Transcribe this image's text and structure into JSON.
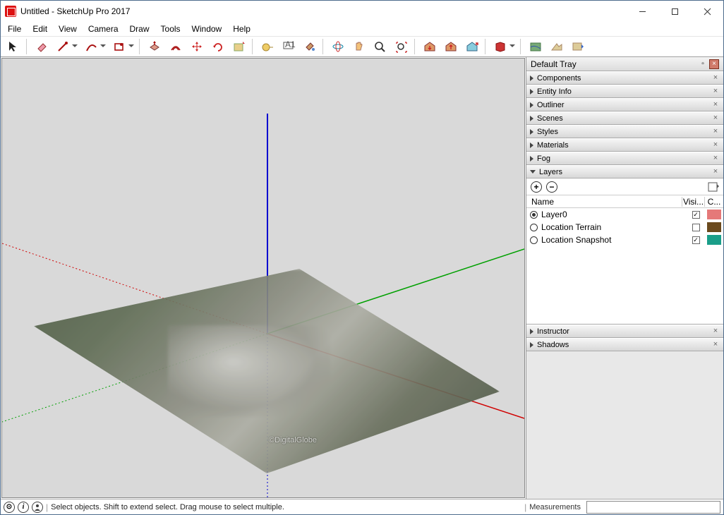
{
  "window": {
    "title": "Untitled - SketchUp Pro 2017"
  },
  "menu": [
    "File",
    "Edit",
    "View",
    "Camera",
    "Draw",
    "Tools",
    "Window",
    "Help"
  ],
  "tray": {
    "title": "Default Tray",
    "panels": [
      {
        "label": "Components",
        "open": false
      },
      {
        "label": "Entity Info",
        "open": false
      },
      {
        "label": "Outliner",
        "open": false
      },
      {
        "label": "Scenes",
        "open": false
      },
      {
        "label": "Styles",
        "open": false
      },
      {
        "label": "Materials",
        "open": false
      },
      {
        "label": "Fog",
        "open": false
      },
      {
        "label": "Layers",
        "open": true
      },
      {
        "label": "Instructor",
        "open": false
      },
      {
        "label": "Shadows",
        "open": false
      }
    ],
    "layers": {
      "headers": {
        "name": "Name",
        "vis": "Visi...",
        "color": "C..."
      },
      "rows": [
        {
          "name": "Layer0",
          "active": true,
          "visible": true,
          "color": "#e57979"
        },
        {
          "name": "Location Terrain",
          "active": false,
          "visible": false,
          "color": "#6b4a1e"
        },
        {
          "name": "Location Snapshot",
          "active": false,
          "visible": true,
          "color": "#1a9e89"
        }
      ]
    }
  },
  "status": {
    "hint": "Select objects. Shift to extend select. Drag mouse to select multiple.",
    "measure_label": "Measurements"
  },
  "viewport": {
    "watermark": "©DigitalGlobe"
  }
}
